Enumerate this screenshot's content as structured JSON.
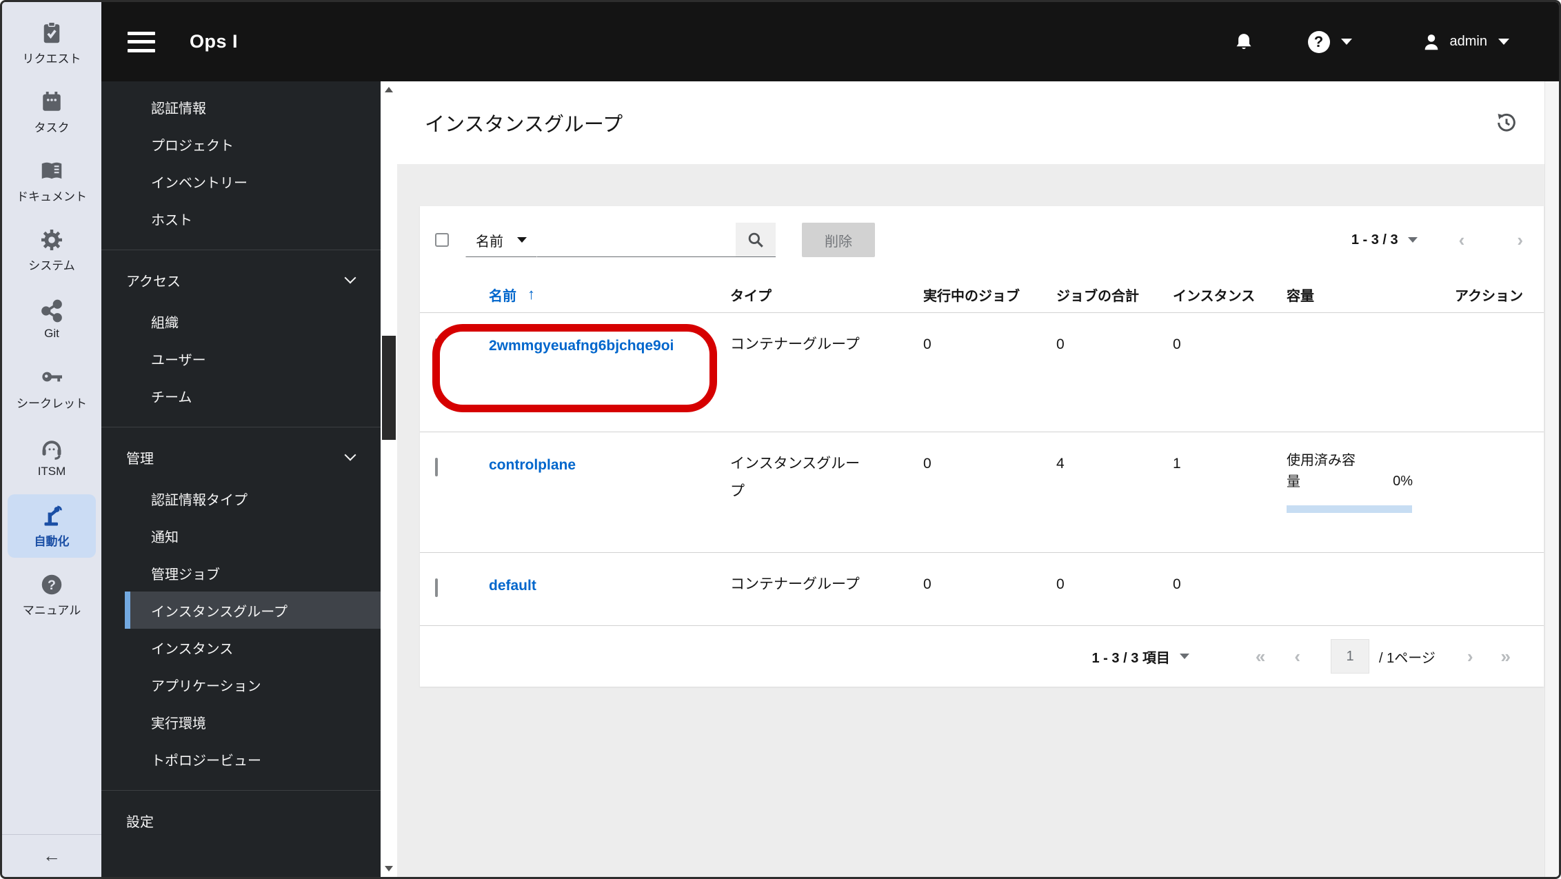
{
  "topbar": {
    "brand": "Ops I",
    "user": "admin"
  },
  "rail": {
    "items": [
      {
        "label": "リクエスト",
        "icon": "clipboard-check-icon"
      },
      {
        "label": "タスク",
        "icon": "calendar-icon"
      },
      {
        "label": "ドキュメント",
        "icon": "book-icon"
      },
      {
        "label": "システム",
        "icon": "gear-icon"
      },
      {
        "label": "Git",
        "icon": "share-nodes-icon"
      },
      {
        "label": "シークレット",
        "icon": "key-icon"
      },
      {
        "label": "ITSM",
        "icon": "headset-icon"
      },
      {
        "label": "自動化",
        "icon": "robot-arm-icon",
        "active": true
      },
      {
        "label": "マニュアル",
        "icon": "question-circle-icon"
      }
    ],
    "collapse_label": "←"
  },
  "sidebar": {
    "groups": [
      {
        "items": [
          "認証情報",
          "プロジェクト",
          "インベントリー",
          "ホスト"
        ]
      },
      {
        "header": "アクセス",
        "items": [
          "組織",
          "ユーザー",
          "チーム"
        ]
      },
      {
        "header": "管理",
        "items": [
          "認証情報タイプ",
          "通知",
          "管理ジョブ",
          "インスタンスグループ",
          "インスタンス",
          "アプリケーション",
          "実行環境",
          "トポロジービュー"
        ],
        "active_item": "インスタンスグループ"
      },
      {
        "header": "設定",
        "items": []
      }
    ]
  },
  "page": {
    "title": "インスタンスグループ"
  },
  "toolbar": {
    "filter_label": "名前",
    "search_value": "",
    "delete_label": "削除",
    "pagination_label": "1 - 3 / 3"
  },
  "table": {
    "columns": [
      "名前",
      "タイプ",
      "実行中のジョブ",
      "ジョブの合計",
      "インスタンス",
      "容量",
      "アクション"
    ],
    "rows": [
      {
        "name": "2wmmgyeuafng6bjchqe9oi",
        "type": "コンテナーグループ",
        "running_jobs": "0",
        "total_jobs": "0",
        "instances": "0",
        "annotated": true
      },
      {
        "name": "controlplane",
        "type": "インスタンスグループ",
        "running_jobs": "0",
        "total_jobs": "4",
        "instances": "1",
        "capacity": {
          "label": "使用済み容量",
          "value": "0%"
        }
      },
      {
        "name": "default",
        "type": "コンテナーグループ",
        "running_jobs": "0",
        "total_jobs": "0",
        "instances": "0"
      }
    ]
  },
  "footer": {
    "items_label": "1 - 3 / 3 項目",
    "page_number": "1",
    "page_total_label": "/ 1ページ",
    "first_glyph": "«",
    "prev_glyph": "‹",
    "next_glyph": "›",
    "last_glyph": "»"
  },
  "colors": {
    "accent_blue": "#0066cc",
    "annotation_red": "#d60000",
    "sidebar_bg": "#212427",
    "selected_border": "#73a9e0",
    "capacity_bar": "#c7ddf3"
  },
  "icons": {
    "hamburger-icon": "menu",
    "bell-icon": "notifications",
    "help-icon": "? circle",
    "user-icon": "person",
    "caret-down-icon": "▾",
    "history-icon": "clock with counterclockwise arrow",
    "search-icon": "magnifier",
    "sort-ascending-icon": "↑",
    "chevron-down-icon": "v"
  }
}
